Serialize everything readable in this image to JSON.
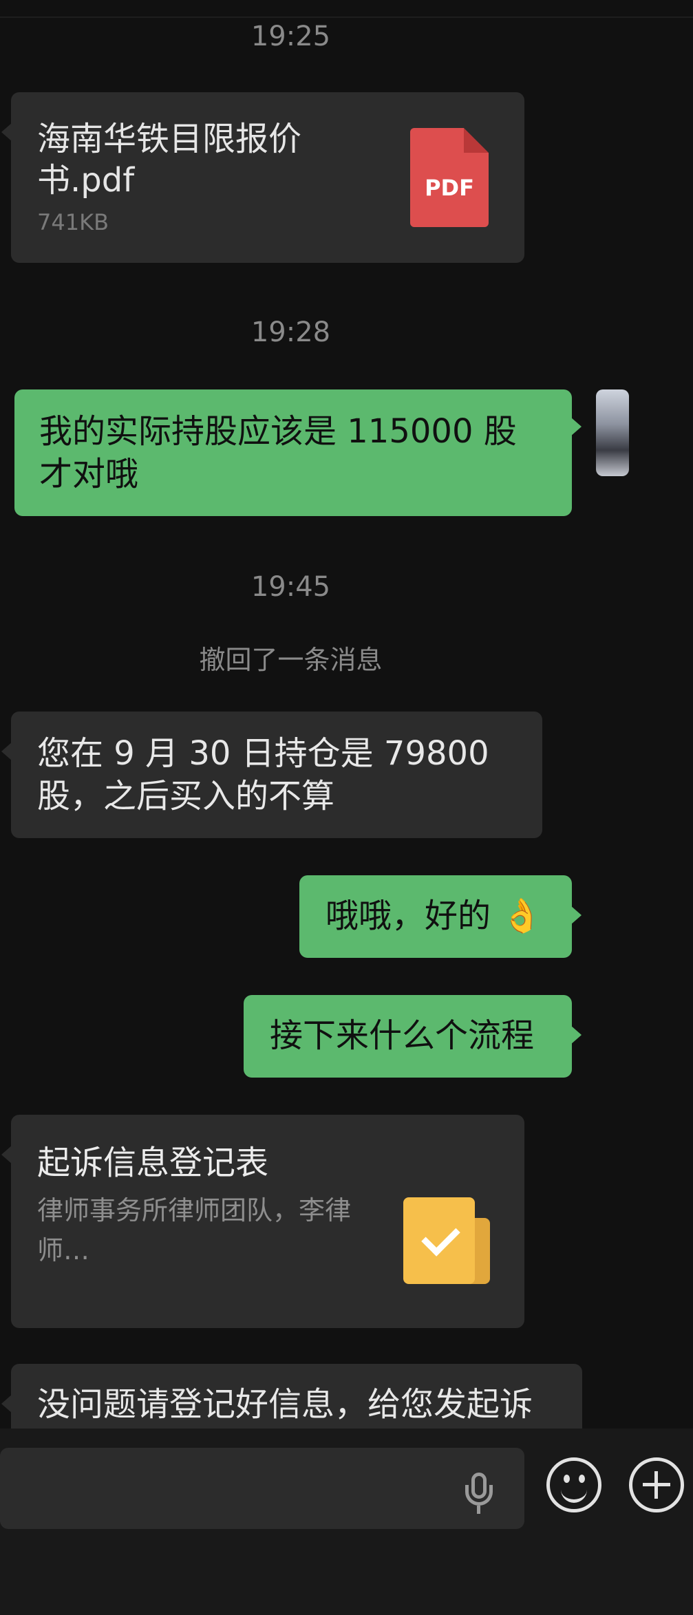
{
  "chat": {
    "timestamps": [
      "19:25",
      "19:28",
      "19:45"
    ],
    "file": {
      "name": "海南华铁目限报价书.pdf",
      "size": "741KB",
      "type_label": "PDF"
    },
    "outgoing_1": "我的实际持股应该是 115000 股才对哦",
    "system_notice": "撤回了一条消息",
    "incoming_1": "您在 9 月 30 日持仓是 79800 股，之后买入的不算",
    "outgoing_2": "哦哦，好的 👌",
    "outgoing_3": "接下来什么个流程",
    "card": {
      "title": "起诉信息登记表",
      "description": "律师事务所律师团队，李律师…"
    },
    "incoming_2": "没问题请登记好信息，给您发起诉"
  },
  "colors": {
    "background": "#111111",
    "incoming_bubble": "#2c2c2c",
    "outgoing_bubble": "#5cb96e",
    "pdf_icon": "#dd4e4e",
    "card_icon": "#f6bf4b"
  },
  "icons": [
    "pdf-icon",
    "check-icon",
    "mic-icon",
    "emoji-icon",
    "plus-icon"
  ]
}
